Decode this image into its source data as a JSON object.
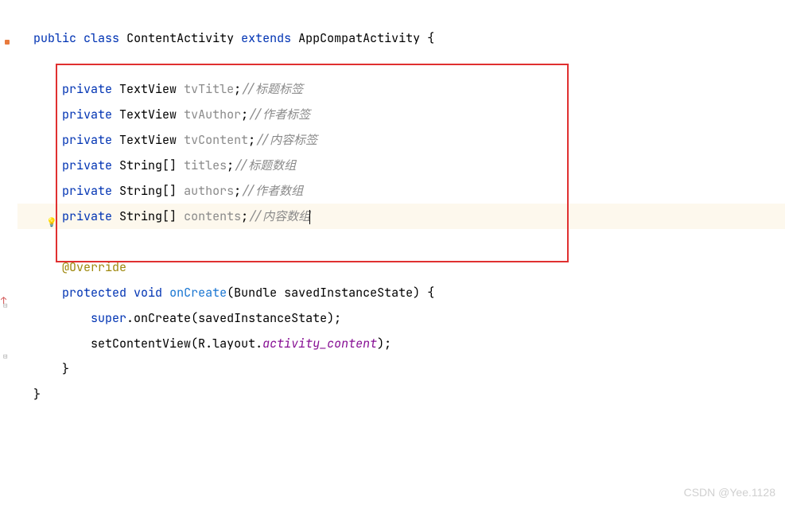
{
  "code": {
    "class_decl": {
      "modifier": "public",
      "keyword": "class",
      "name": "ContentActivity",
      "extends_kw": "extends",
      "parent": "AppCompatActivity",
      "open_brace": "{"
    },
    "fields": [
      {
        "modifier": "private",
        "type": "TextView",
        "name": "tvTitle",
        "semi": ";",
        "comment": "//标题标签"
      },
      {
        "modifier": "private",
        "type": "TextView",
        "name": "tvAuthor",
        "semi": ";",
        "comment": "//作者标签"
      },
      {
        "modifier": "private",
        "type": "TextView",
        "name": "tvContent",
        "semi": ";",
        "comment": "//内容标签"
      },
      {
        "modifier": "private",
        "type": "String[]",
        "name": "titles",
        "semi": ";",
        "comment": "//标题数组"
      },
      {
        "modifier": "private",
        "type": "String[]",
        "name": "authors",
        "semi": ";",
        "comment": "//作者数组"
      },
      {
        "modifier": "private",
        "type": "String[]",
        "name": "contents",
        "semi": ";",
        "comment": "//内容数组"
      }
    ],
    "annotation": "@Override",
    "method": {
      "modifier": "protected",
      "return": "void",
      "name": "onCreate",
      "param_type": "Bundle",
      "param_name": "savedInstanceState",
      "open": "(",
      "close": ")",
      "brace": "{"
    },
    "super_call": {
      "super": "super",
      "dot": ".",
      "method": "onCreate",
      "open": "(",
      "arg": "savedInstanceState",
      "close": ");"
    },
    "set_content": {
      "method": "setContentView",
      "open": "(",
      "r": "R",
      "dot1": ".",
      "layout": "layout",
      "dot2": ".",
      "resource": "activity_content",
      "close": ");"
    },
    "close_method": "}",
    "close_class": "}"
  },
  "watermark": "CSDN @Yee.1128"
}
